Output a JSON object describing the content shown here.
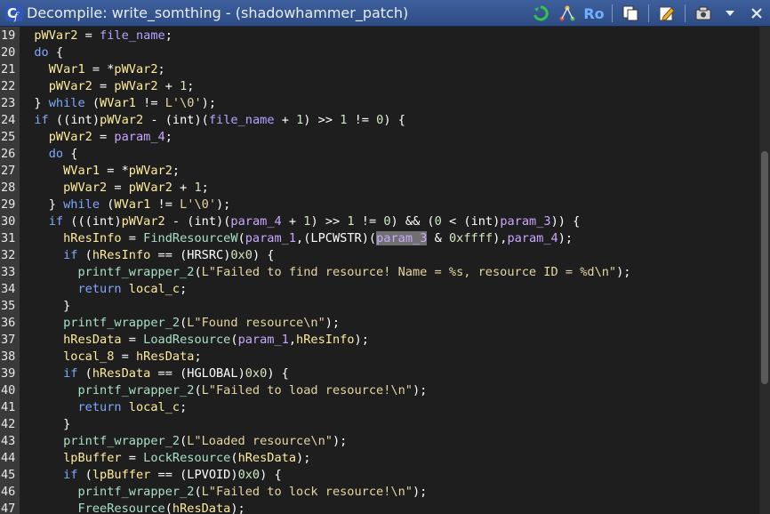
{
  "window": {
    "title": "Decompile: write_somthing -  (shadowhammer_patch)",
    "readonly_label": "Ro"
  },
  "lines": [
    {
      "n": "19",
      "tokens": [
        [
          "  ",
          "p"
        ],
        [
          "pWVar2",
          "v"
        ],
        [
          " = ",
          "p"
        ],
        [
          "file_name",
          "g"
        ],
        [
          ";",
          "p"
        ]
      ]
    },
    {
      "n": "20",
      "tokens": [
        [
          "  ",
          "p"
        ],
        [
          "do",
          "k"
        ],
        [
          " {",
          "p"
        ]
      ]
    },
    {
      "n": "21",
      "tokens": [
        [
          "    ",
          "p"
        ],
        [
          "WVar1",
          "v"
        ],
        [
          " = *",
          "p"
        ],
        [
          "pWVar2",
          "v"
        ],
        [
          ";",
          "p"
        ]
      ]
    },
    {
      "n": "22",
      "tokens": [
        [
          "    ",
          "p"
        ],
        [
          "pWVar2",
          "v"
        ],
        [
          " = ",
          "p"
        ],
        [
          "pWVar2",
          "v"
        ],
        [
          " + ",
          "p"
        ],
        [
          "1",
          "n"
        ],
        [
          ";",
          "p"
        ]
      ]
    },
    {
      "n": "23",
      "tokens": [
        [
          "  } ",
          "p"
        ],
        [
          "while",
          "k"
        ],
        [
          " (",
          "p"
        ],
        [
          "WVar1",
          "v"
        ],
        [
          " != ",
          "p"
        ],
        [
          "L'\\0'",
          "s"
        ],
        [
          ");",
          "p"
        ]
      ]
    },
    {
      "n": "24",
      "tokens": [
        [
          "  ",
          "p"
        ],
        [
          "if",
          "k"
        ],
        [
          " ((",
          "p"
        ],
        [
          "int",
          "t"
        ],
        [
          ")",
          "p"
        ],
        [
          "pWVar2",
          "v"
        ],
        [
          " - (",
          "p"
        ],
        [
          "int",
          "t"
        ],
        [
          ")(",
          "p"
        ],
        [
          "file_name",
          "g"
        ],
        [
          " + ",
          "p"
        ],
        [
          "1",
          "n"
        ],
        [
          ") >> ",
          "p"
        ],
        [
          "1",
          "n"
        ],
        [
          " != ",
          "p"
        ],
        [
          "0",
          "n"
        ],
        [
          ") {",
          "p"
        ]
      ]
    },
    {
      "n": "25",
      "tokens": [
        [
          "    ",
          "p"
        ],
        [
          "pWVar2",
          "v"
        ],
        [
          " = ",
          "p"
        ],
        [
          "param_4",
          "a"
        ],
        [
          ";",
          "p"
        ]
      ]
    },
    {
      "n": "26",
      "tokens": [
        [
          "    ",
          "p"
        ],
        [
          "do",
          "k"
        ],
        [
          " {",
          "p"
        ]
      ]
    },
    {
      "n": "27",
      "tokens": [
        [
          "      ",
          "p"
        ],
        [
          "WVar1",
          "v"
        ],
        [
          " = *",
          "p"
        ],
        [
          "pWVar2",
          "v"
        ],
        [
          ";",
          "p"
        ]
      ]
    },
    {
      "n": "28",
      "tokens": [
        [
          "      ",
          "p"
        ],
        [
          "pWVar2",
          "v"
        ],
        [
          " = ",
          "p"
        ],
        [
          "pWVar2",
          "v"
        ],
        [
          " + ",
          "p"
        ],
        [
          "1",
          "n"
        ],
        [
          ";",
          "p"
        ]
      ]
    },
    {
      "n": "29",
      "tokens": [
        [
          "    } ",
          "p"
        ],
        [
          "while",
          "k"
        ],
        [
          " (",
          "p"
        ],
        [
          "WVar1",
          "v"
        ],
        [
          " != ",
          "p"
        ],
        [
          "L'\\0'",
          "s"
        ],
        [
          ");",
          "p"
        ]
      ]
    },
    {
      "n": "30",
      "tokens": [
        [
          "    ",
          "p"
        ],
        [
          "if",
          "k"
        ],
        [
          " (((",
          "p"
        ],
        [
          "int",
          "t"
        ],
        [
          ")",
          "p"
        ],
        [
          "pWVar2",
          "v"
        ],
        [
          " - (",
          "p"
        ],
        [
          "int",
          "t"
        ],
        [
          ")(",
          "p"
        ],
        [
          "param_4",
          "a"
        ],
        [
          " + ",
          "p"
        ],
        [
          "1",
          "n"
        ],
        [
          ") >> ",
          "p"
        ],
        [
          "1",
          "n"
        ],
        [
          " != ",
          "p"
        ],
        [
          "0",
          "n"
        ],
        [
          ") && (",
          "p"
        ],
        [
          "0",
          "n"
        ],
        [
          " < (",
          "p"
        ],
        [
          "int",
          "t"
        ],
        [
          ")",
          "p"
        ],
        [
          "param_3",
          "a"
        ],
        [
          ")) {",
          "p"
        ]
      ]
    },
    {
      "n": "31",
      "tokens": [
        [
          "      ",
          "p"
        ],
        [
          "hResInfo",
          "v"
        ],
        [
          " = ",
          "p"
        ],
        [
          "FindResourceW",
          "f"
        ],
        [
          "(",
          "p"
        ],
        [
          "param_1",
          "a"
        ],
        [
          ",(",
          "p"
        ],
        [
          "LPCWSTR",
          "t"
        ],
        [
          ")(",
          "p"
        ],
        [
          "param_3",
          "h"
        ],
        [
          " & ",
          "p"
        ],
        [
          "0xffff",
          "n"
        ],
        [
          "),",
          "p"
        ],
        [
          "param_4",
          "a"
        ],
        [
          ");",
          "p"
        ]
      ]
    },
    {
      "n": "32",
      "tokens": [
        [
          "      ",
          "p"
        ],
        [
          "if",
          "k"
        ],
        [
          " (",
          "p"
        ],
        [
          "hResInfo",
          "v"
        ],
        [
          " == (",
          "p"
        ],
        [
          "HRSRC",
          "t"
        ],
        [
          ")",
          "p"
        ],
        [
          "0x0",
          "n"
        ],
        [
          ") {",
          "p"
        ]
      ]
    },
    {
      "n": "33",
      "tokens": [
        [
          "        ",
          "p"
        ],
        [
          "printf_wrapper_2",
          "f"
        ],
        [
          "(",
          "p"
        ],
        [
          "L\"Failed to find resource! Name = %s, resource ID = %d\\n\"",
          "s"
        ],
        [
          ");",
          "p"
        ]
      ]
    },
    {
      "n": "34",
      "tokens": [
        [
          "        ",
          "p"
        ],
        [
          "return",
          "k"
        ],
        [
          " ",
          "p"
        ],
        [
          "local_c",
          "v"
        ],
        [
          ";",
          "p"
        ]
      ]
    },
    {
      "n": "35",
      "tokens": [
        [
          "      }",
          "p"
        ]
      ]
    },
    {
      "n": "36",
      "tokens": [
        [
          "      ",
          "p"
        ],
        [
          "printf_wrapper_2",
          "f"
        ],
        [
          "(",
          "p"
        ],
        [
          "L\"Found resource\\n\"",
          "s"
        ],
        [
          ");",
          "p"
        ]
      ]
    },
    {
      "n": "37",
      "tokens": [
        [
          "      ",
          "p"
        ],
        [
          "hResData",
          "v"
        ],
        [
          " = ",
          "p"
        ],
        [
          "LoadResource",
          "f"
        ],
        [
          "(",
          "p"
        ],
        [
          "param_1",
          "a"
        ],
        [
          ",",
          "p"
        ],
        [
          "hResInfo",
          "v"
        ],
        [
          ");",
          "p"
        ]
      ]
    },
    {
      "n": "38",
      "tokens": [
        [
          "      ",
          "p"
        ],
        [
          "local_8",
          "v"
        ],
        [
          " = ",
          "p"
        ],
        [
          "hResData",
          "v"
        ],
        [
          ";",
          "p"
        ]
      ]
    },
    {
      "n": "39",
      "tokens": [
        [
          "      ",
          "p"
        ],
        [
          "if",
          "k"
        ],
        [
          " (",
          "p"
        ],
        [
          "hResData",
          "v"
        ],
        [
          " == (",
          "p"
        ],
        [
          "HGLOBAL",
          "t"
        ],
        [
          ")",
          "p"
        ],
        [
          "0x0",
          "n"
        ],
        [
          ") {",
          "p"
        ]
      ]
    },
    {
      "n": "40",
      "tokens": [
        [
          "        ",
          "p"
        ],
        [
          "printf_wrapper_2",
          "f"
        ],
        [
          "(",
          "p"
        ],
        [
          "L\"Failed to load resource!\\n\"",
          "s"
        ],
        [
          ");",
          "p"
        ]
      ]
    },
    {
      "n": "41",
      "tokens": [
        [
          "        ",
          "p"
        ],
        [
          "return",
          "k"
        ],
        [
          " ",
          "p"
        ],
        [
          "local_c",
          "v"
        ],
        [
          ";",
          "p"
        ]
      ]
    },
    {
      "n": "42",
      "tokens": [
        [
          "      }",
          "p"
        ]
      ]
    },
    {
      "n": "43",
      "tokens": [
        [
          "      ",
          "p"
        ],
        [
          "printf_wrapper_2",
          "f"
        ],
        [
          "(",
          "p"
        ],
        [
          "L\"Loaded resource\\n\"",
          "s"
        ],
        [
          ");",
          "p"
        ]
      ]
    },
    {
      "n": "44",
      "tokens": [
        [
          "      ",
          "p"
        ],
        [
          "lpBuffer",
          "v"
        ],
        [
          " = ",
          "p"
        ],
        [
          "LockResource",
          "f"
        ],
        [
          "(",
          "p"
        ],
        [
          "hResData",
          "v"
        ],
        [
          ");",
          "p"
        ]
      ]
    },
    {
      "n": "45",
      "tokens": [
        [
          "      ",
          "p"
        ],
        [
          "if",
          "k"
        ],
        [
          " (",
          "p"
        ],
        [
          "lpBuffer",
          "v"
        ],
        [
          " == (",
          "p"
        ],
        [
          "LPVOID",
          "t"
        ],
        [
          ")",
          "p"
        ],
        [
          "0x0",
          "n"
        ],
        [
          ") {",
          "p"
        ]
      ]
    },
    {
      "n": "46",
      "tokens": [
        [
          "        ",
          "p"
        ],
        [
          "printf_wrapper_2",
          "f"
        ],
        [
          "(",
          "p"
        ],
        [
          "L\"Failed to lock resource!\\n\"",
          "s"
        ],
        [
          ");",
          "p"
        ]
      ]
    },
    {
      "n": "47",
      "tokens": [
        [
          "        ",
          "p"
        ],
        [
          "FreeResource",
          "f"
        ],
        [
          "(",
          "p"
        ],
        [
          "hResData",
          "v"
        ],
        [
          ");",
          "p"
        ]
      ]
    }
  ],
  "token_classes": {
    "p": "",
    "v": "t-var",
    "k": "t-kw",
    "f": "t-fn",
    "t": "t-type",
    "n": "t-num",
    "s": "t-str",
    "a": "t-param",
    "g": "t-glob",
    "h": "t-param t-hl"
  },
  "icons": [
    "decompiler-icon",
    "refresh-icon",
    "graph-icon",
    "copy-icon",
    "edit-icon",
    "snapshot-icon",
    "menu-chevron-icon",
    "close-icon"
  ]
}
